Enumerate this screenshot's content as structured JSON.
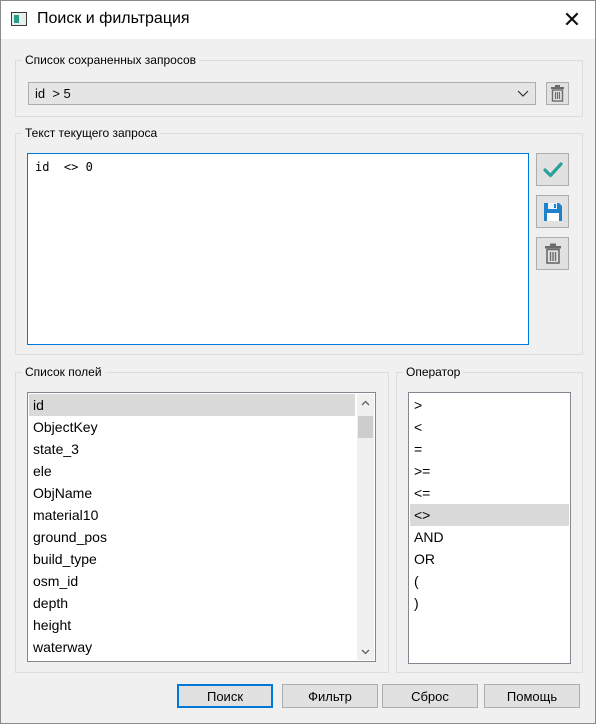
{
  "window": {
    "title": "Поиск и фильтрация",
    "close_glyph": "✕"
  },
  "saved_queries": {
    "label": "Список сохраненных запросов",
    "selected": "id  > 5",
    "delete_icon": "trash-icon"
  },
  "current_query": {
    "label": "Текст текущего запроса",
    "text": "id  <> 0",
    "apply_icon": "checkmark-icon",
    "save_icon": "floppy-disk-icon",
    "delete_icon": "trash-icon"
  },
  "fields": {
    "label": "Список полей",
    "items": [
      "id",
      "ObjectKey",
      "state_3",
      "ele",
      "ObjName",
      "material10",
      "ground_pos",
      "build_type",
      "osm_id",
      "depth",
      "height",
      "waterway"
    ],
    "selected": "id"
  },
  "operators": {
    "label": "Оператор",
    "items": [
      ">",
      "<",
      "=",
      ">=",
      "<=",
      "<>",
      "AND",
      "OR",
      "(",
      ")"
    ],
    "selected": "<>"
  },
  "buttons": {
    "search": "Поиск",
    "filter": "Фильтр",
    "reset": "Сброс",
    "help": "Помощь"
  },
  "colors": {
    "accent": "#0078d7",
    "check": "#2aa198",
    "floppy": "#1f82c9"
  }
}
